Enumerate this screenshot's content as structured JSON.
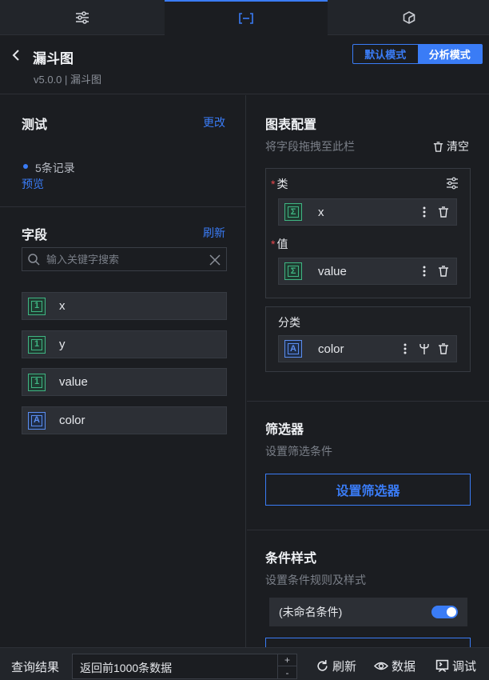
{
  "tabs": [
    {
      "name": "style-settings",
      "icon": "sliders-icon"
    },
    {
      "name": "field-config",
      "icon": "bracket-field-icon"
    },
    {
      "name": "interaction",
      "icon": "hexagon-icon"
    }
  ],
  "header": {
    "title": "漏斗图",
    "subtitle": "v5.0.0 | 漏斗图",
    "mode_default": "默认模式",
    "mode_analysis": "分析模式"
  },
  "dataset": {
    "title": "测试",
    "change_link": "更改",
    "records": "5条记录",
    "preview_link": "预览"
  },
  "fields_section": {
    "title": "字段",
    "refresh_link": "刷新",
    "search_placeholder": "输入关键字搜索",
    "items": [
      {
        "name": "x",
        "type": "1"
      },
      {
        "name": "y",
        "type": "1"
      },
      {
        "name": "value",
        "type": "1"
      },
      {
        "name": "color",
        "type": "A"
      }
    ]
  },
  "chart_config": {
    "title": "图表配置",
    "hint": "将字段拖拽至此栏",
    "clear_label": "清空",
    "category_label": "类",
    "category_field": "x",
    "category_badge": "Σ",
    "value_label": "值",
    "value_field": "value",
    "value_badge": "Σ",
    "group_label": "分类",
    "group_field": "color",
    "group_badge": "A"
  },
  "filter": {
    "title": "筛选器",
    "hint": "设置筛选条件",
    "button": "设置筛选器"
  },
  "conditional": {
    "title": "条件样式",
    "hint": "设置条件规则及样式",
    "rule_name": "(未命名条件)",
    "rule_enabled": true
  },
  "bottom": {
    "label": "查询结果",
    "limit": "返回前1000条数据",
    "plus": "+",
    "minus": "-",
    "refresh": "刷新",
    "data": "数据",
    "debug": "调试"
  },
  "colors": {
    "accent": "#3a7cf6",
    "numeric_badge": "#3fb583",
    "text_badge": "#5b8ef0",
    "required": "#e5484d"
  }
}
